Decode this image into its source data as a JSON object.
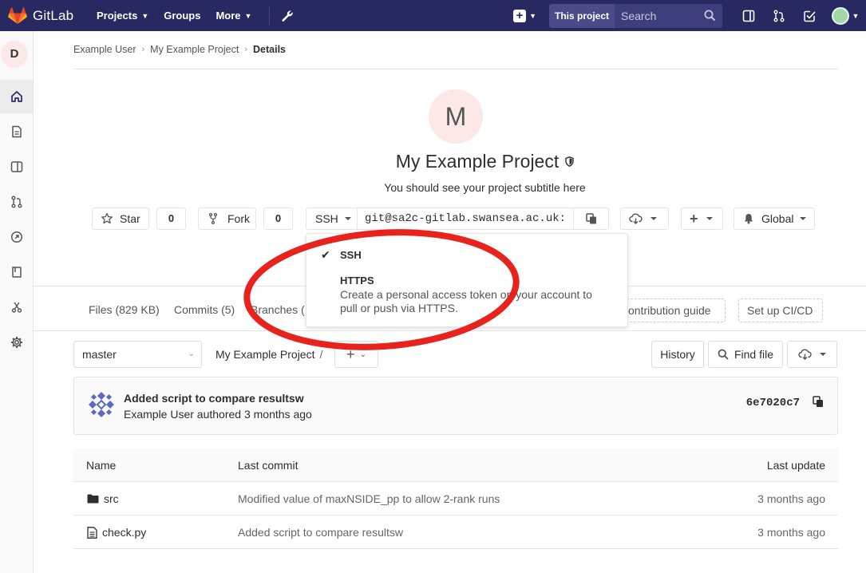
{
  "navbar": {
    "brand": "GitLab",
    "projects": "Projects",
    "groups": "Groups",
    "more": "More",
    "scope": "This project",
    "search_placeholder": "Search"
  },
  "sidebar": {
    "avatar_letter": "D",
    "items": [
      "home-icon",
      "doc-icon",
      "issues-icon",
      "merge-request-icon",
      "ci-icon",
      "wiki-icon",
      "snippets-icon",
      "settings-icon"
    ]
  },
  "breadcrumb": {
    "user": "Example User",
    "project": "My Example Project",
    "current": "Details"
  },
  "project": {
    "avatar_letter": "M",
    "title": "My Example Project",
    "subtitle": "You should see your project subtitle here"
  },
  "actions": {
    "star": "Star",
    "star_count": "0",
    "fork": "Fork",
    "fork_count": "0",
    "protocol": "SSH",
    "clone_url": "git@sa2c-gitlab.swansea.ac.uk:",
    "notification": "Global"
  },
  "clone_dropdown": {
    "ssh": "SSH",
    "https_title": "HTTPS",
    "https_desc": "Create a personal access token on your account to pull or push via HTTPS."
  },
  "stats": {
    "files": "Files (829 KB)",
    "commits": "Commits (5)",
    "branches": "Branches (",
    "contribution_guide": "ontribution guide",
    "setup_ci": "Set up CI/CD"
  },
  "tree": {
    "branch": "master",
    "path": "My Example Project",
    "path_sep": "/",
    "history": "History",
    "find_file": "Find file"
  },
  "last_commit": {
    "title": "Added script to compare resultsw",
    "meta": "Example User authored 3 months ago",
    "sha": "6e7020c7"
  },
  "files": {
    "headers": {
      "name": "Name",
      "last_commit": "Last commit",
      "last_update": "Last update"
    },
    "rows": [
      {
        "type": "folder",
        "name": "src",
        "commit": "Modified value of maxNSIDE_pp to allow 2-rank runs",
        "date": "3 months ago"
      },
      {
        "type": "file",
        "name": "check.py",
        "commit": "Added script to compare resultsw",
        "date": "3 months ago"
      }
    ]
  },
  "colors": {
    "navbar": "#292961",
    "annotation_red": "#e8231e"
  }
}
